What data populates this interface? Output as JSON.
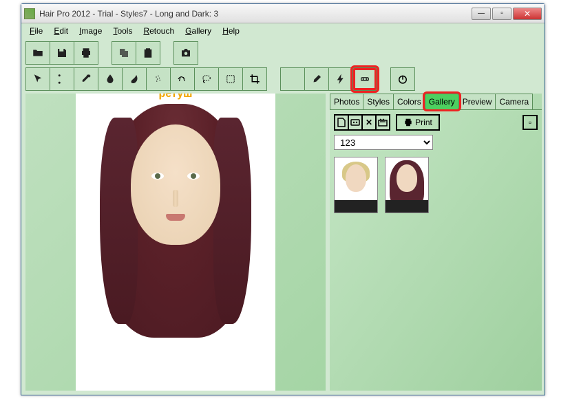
{
  "window": {
    "title": "Hair Pro 2012 - Trial - Styles7 - Long and Dark: 3"
  },
  "menus": {
    "file": "File",
    "edit": "Edit",
    "image": "Image",
    "tools": "Tools",
    "retouch": "Retouch",
    "gallery": "Gallery",
    "help": "Help"
  },
  "toolbar_icons": {
    "open": "open-icon",
    "save": "save-icon",
    "print": "print-icon",
    "copy": "copy-icon",
    "paste": "paste-icon",
    "camera": "camera-icon",
    "pointer": "pointer-icon",
    "scissors": "scissors-icon",
    "eyedropper": "eyedropper-icon",
    "blur": "blur-icon",
    "smudge": "smudge-icon",
    "spray": "spray-icon",
    "hairline": "hairline-icon",
    "lasso": "lasso-icon",
    "marquee": "marquee-icon",
    "crop": "crop-icon",
    "wand": "wand-icon",
    "brush": "brush-icon",
    "flash": "flash-icon",
    "tape": "tape-icon",
    "power": "power-icon"
  },
  "tabs": {
    "photos": "Photos",
    "styles": "Styles",
    "colors": "Colors",
    "gallery": "Gallery",
    "preview": "Preview",
    "camera": "Camera",
    "active": "gallery"
  },
  "panel": {
    "print_label": "Print",
    "dropdown_value": "123"
  },
  "thumbnails": [
    {
      "id": "thumb1",
      "desc": "short-blonde"
    },
    {
      "id": "thumb2",
      "desc": "long-dark"
    }
  ],
  "watermark": "ретуш"
}
